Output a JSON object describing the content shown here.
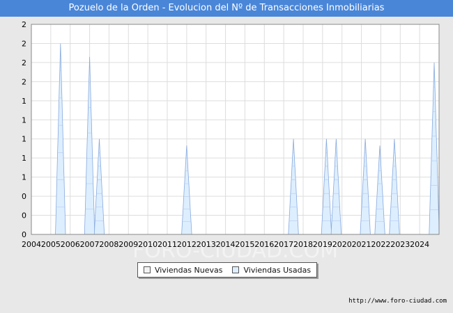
{
  "title": "Pozuelo de la Orden - Evolucion del Nº de Transacciones Inmobiliarias",
  "source": "http://www.foro-ciudad.com",
  "watermark": "FORO-CIUDAD.COM",
  "colors": {
    "title_bg": "#4a86d8",
    "nuevas_fill": "#f2f2f2",
    "usadas_fill": "#ddeeff",
    "usadas_line": "#88aadd"
  },
  "chart_data": {
    "type": "area",
    "title": "Pozuelo de la Orden - Evolucion del Nº de Transacciones Inmobiliarias",
    "xlim": [
      2004,
      2025
    ],
    "ylim": [
      0,
      2.2
    ],
    "y_tick_values": [
      0,
      0.2,
      0.4,
      0.6,
      0.8,
      1.0,
      1.2,
      1.4,
      1.6,
      1.8,
      2.0,
      2.2
    ],
    "y_tick_labels": [
      "0",
      "0",
      "0",
      "1",
      "1",
      "1",
      "1",
      "1",
      "2",
      "2",
      "2",
      "2"
    ],
    "x_ticks": [
      2004,
      2005,
      2006,
      2007,
      2008,
      2009,
      2010,
      2011,
      2012,
      2013,
      2014,
      2015,
      2016,
      2017,
      2018,
      2019,
      2020,
      2021,
      2022,
      2023,
      2024
    ],
    "grid": true,
    "legend_position": "bottom",
    "series": [
      {
        "name": "Viviendas Nuevas",
        "color": "#f2f2f2",
        "peaks": []
      },
      {
        "name": "Viviendas Usadas",
        "color": "#ddeeff",
        "peaks": [
          {
            "x": 2005.5,
            "y": 2
          },
          {
            "x": 2007.0,
            "y": 1.86
          },
          {
            "x": 2007.5,
            "y": 1
          },
          {
            "x": 2012.0,
            "y": 0.93
          },
          {
            "x": 2017.5,
            "y": 1
          },
          {
            "x": 2019.2,
            "y": 1
          },
          {
            "x": 2019.7,
            "y": 1
          },
          {
            "x": 2021.2,
            "y": 1
          },
          {
            "x": 2021.95,
            "y": 0.93
          },
          {
            "x": 2022.7,
            "y": 1
          },
          {
            "x": 2024.75,
            "y": 1.8
          }
        ]
      }
    ]
  },
  "legend": {
    "nuevas": "Viviendas Nuevas",
    "usadas": "Viviendas Usadas"
  }
}
